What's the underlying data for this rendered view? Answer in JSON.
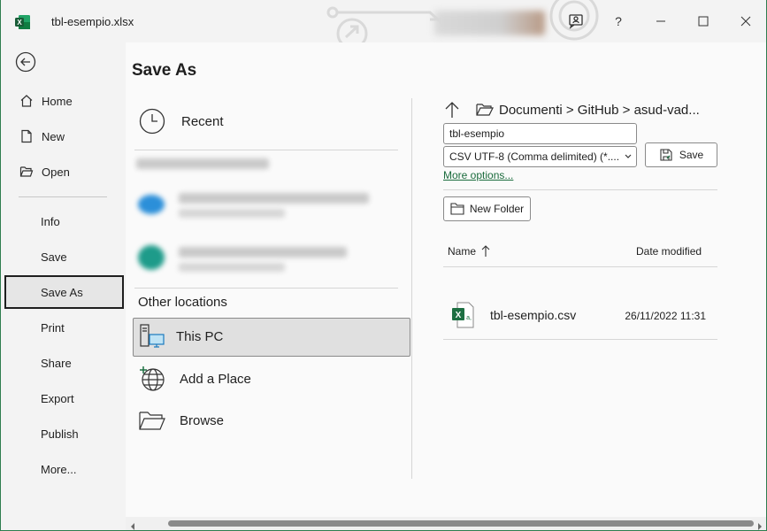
{
  "titlebar": {
    "document_title": "tbl-esempio.xlsx",
    "help_label": "?"
  },
  "nav": {
    "home": "Home",
    "new": "New",
    "open": "Open",
    "info": "Info",
    "save": "Save",
    "save_as": "Save As",
    "print": "Print",
    "share": "Share",
    "export": "Export",
    "publish": "Publish",
    "more": "More..."
  },
  "main": {
    "title": "Save As",
    "recent": "Recent",
    "other_locations": "Other locations",
    "this_pc": "This PC",
    "add_place": "Add a Place",
    "browse": "Browse"
  },
  "save_pane": {
    "path": "Documenti > GitHub > asud-vad...",
    "filename_value": "tbl-esempio",
    "filetype_value": "CSV UTF-8 (Comma delimited) (*....",
    "save_button": "Save",
    "more_options": "More options...",
    "new_folder": "New Folder",
    "col_name": "Name",
    "col_date": "Date modified",
    "files": [
      {
        "name": "tbl-esempio.csv",
        "date": "26/11/2022 11:31"
      }
    ]
  },
  "colors": {
    "excel_green": "#1d6f42",
    "link_green": "#1a6b3c",
    "onedrive_blue": "#2b8fd9",
    "sites_teal": "#1e9b8a"
  }
}
